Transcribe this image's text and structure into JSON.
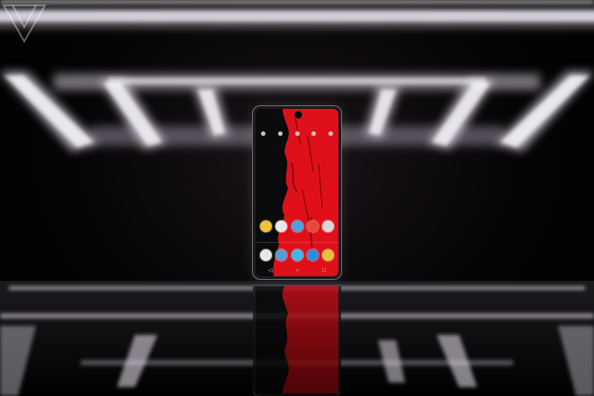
{
  "scene": {
    "description_kind": "photo",
    "accent_colors": {
      "light_bar": "#ece4f2",
      "screen_red": "#e0101a",
      "background": "#050405",
      "phone_frame": "#6d6d72"
    }
  },
  "phone": {
    "quick_settings_icon_count": 5,
    "app_row_1": [
      "#f3c038",
      "#e8e8e8",
      "#4aa3e0",
      "#e64a3a",
      "#d8d8d8"
    ],
    "app_row_2": [
      "#e8e8e8",
      "#5b9bd5",
      "#3fb6e8",
      "#2f8be0",
      "#e8c13a"
    ],
    "nav_icons": [
      "back-icon",
      "home-icon",
      "recents-icon"
    ],
    "nav_glyphs": [
      "◁",
      "○",
      "□"
    ]
  },
  "watermark": {
    "icon": "verge-logo-icon"
  }
}
